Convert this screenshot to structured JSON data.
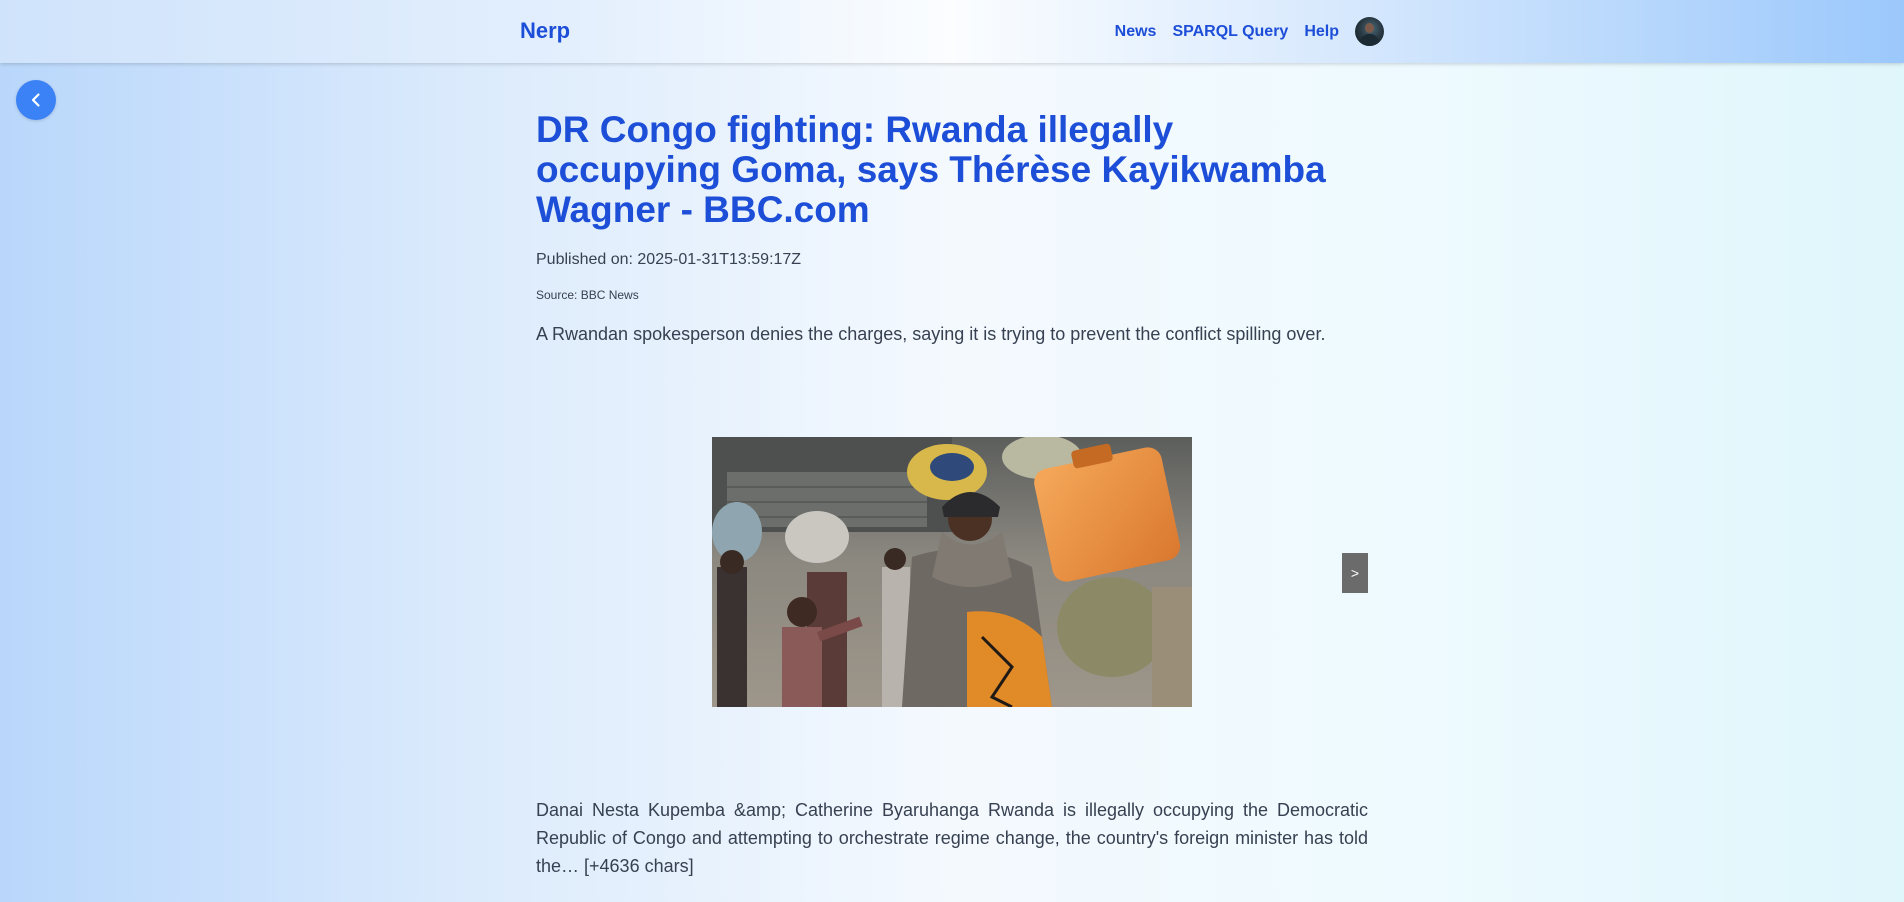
{
  "header": {
    "brand": "Nerp",
    "nav": {
      "news": "News",
      "sparql": "SPARQL Query",
      "help": "Help"
    }
  },
  "article": {
    "title": "DR Congo fighting: Rwanda illegally occupying Goma, says Thérèse Kayikwamba Wagner - BBC.com",
    "published": "Published on: 2025-01-31T13:59:17Z",
    "source": "Source: BBC News",
    "description": "A Rwandan spokesperson denies the charges, saying it is trying to prevent the conflict spilling over.",
    "content": "Danai Nesta Kupemba &amp; Catherine Byaruhanga Rwanda is illegally occupying the Democratic Republic of Congo and attempting to orchestrate regime change, the country's foreign minister has told the… [+4636 chars]"
  },
  "carousel": {
    "next_label": ">"
  },
  "icons": {
    "back": "chevron-left-icon",
    "avatar": "user-avatar"
  },
  "colors": {
    "accent": "#1d4ed8",
    "back_button": "#3b82f6",
    "text": "#374151"
  }
}
